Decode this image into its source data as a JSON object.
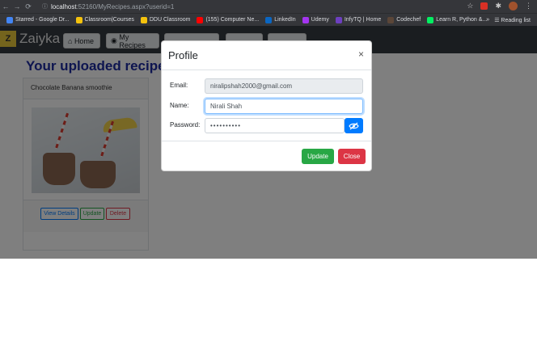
{
  "browser": {
    "url_host": "localhost",
    "url_path": ":52160/MyRecipes.aspx?userid=1",
    "bookmarks": [
      {
        "label": "Starred - Google Dr...",
        "color": "#4285f4"
      },
      {
        "label": "Classroom|Courses",
        "color": "#f4c20d"
      },
      {
        "label": "DDU Classroom",
        "color": "#f4c20d"
      },
      {
        "label": "(155) Computer Ne...",
        "color": "#ff0000"
      },
      {
        "label": "LinkedIn",
        "color": "#0a66c2"
      },
      {
        "label": "Udemy",
        "color": "#a435f0"
      },
      {
        "label": "InfyTQ | Home",
        "color": "#6d3fc0"
      },
      {
        "label": "Codechef",
        "color": "#5b4638"
      },
      {
        "label": "Learn R, Python &...",
        "color": "#03ef62"
      }
    ],
    "reading_list": "Reading list"
  },
  "navbar": {
    "brand": "Zaiyka",
    "logo": "Z",
    "items": [
      {
        "label": "Home",
        "icon": "home-icon"
      },
      {
        "label": "My Recipes",
        "icon": "users-icon"
      }
    ]
  },
  "main": {
    "heading": "Your uploaded recipes",
    "recipe": {
      "title": "Chocolate Banana smoothie",
      "buttons": [
        "View Details",
        "Update",
        "Delete"
      ]
    }
  },
  "modal": {
    "title": "Profile",
    "close": "×",
    "email_label": "Email:",
    "email_value": "niralipshah2000@gmail.com",
    "name_label": "Name:",
    "name_value": "Nirali Shah",
    "password_label": "Password:",
    "password_value": "••••••••••",
    "update_label": "Update",
    "close_label": "Close"
  },
  "colors": {
    "update_green": "#28a745",
    "close_red": "#dc3545",
    "eye_blue": "#007bff",
    "heading_blue": "#1c2ba0"
  }
}
